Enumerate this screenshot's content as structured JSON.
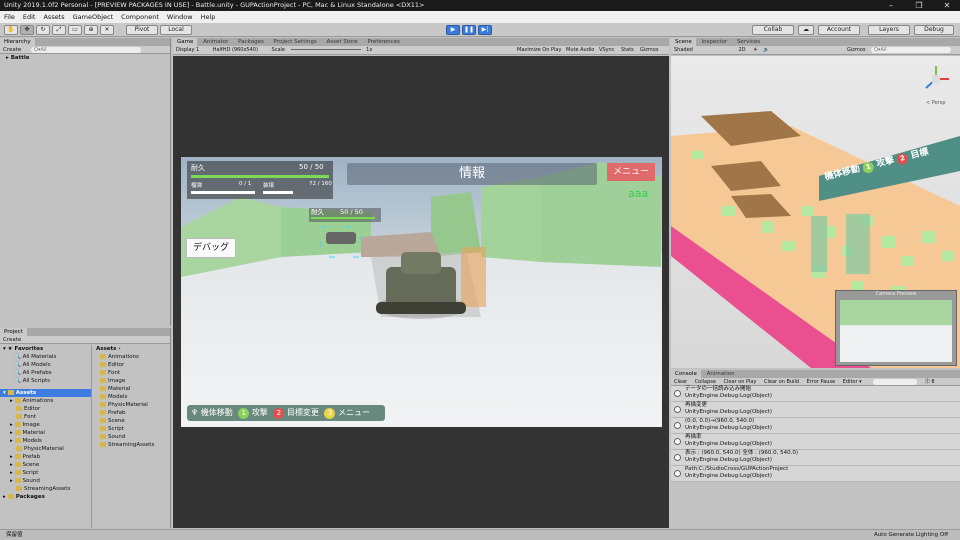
{
  "window": {
    "title": "Unity 2019.1.0f2 Personal - [PREVIEW PACKAGES IN USE] - Battle.unity - GUPActionProject - PC, Mac & Linux Standalone <DX11>"
  },
  "menu": [
    "File",
    "Edit",
    "Assets",
    "GameObject",
    "Component",
    "Window",
    "Help"
  ],
  "toolbar": {
    "pivot": "Pivot",
    "local": "Local",
    "collab": "Collab",
    "account": "Account",
    "layers": "Layers",
    "layout": "Debug"
  },
  "hierarchy": {
    "tab": "Hierarchy",
    "create": "Create",
    "search": "Q▾All",
    "scene": "Battle"
  },
  "project": {
    "tab": "Project",
    "create": "Create",
    "favorites_header": "Favorites",
    "favorites": [
      "All Materials",
      "All Models",
      "All Prefabs",
      "All Scripts"
    ],
    "assets_header": "Assets",
    "asset_tree": [
      "Animations",
      "Editor",
      "Font",
      "Image",
      "Material",
      "Models",
      "PhysicMaterial",
      "Prefab",
      "Scene",
      "Script",
      "Sound",
      "StreamingAssets"
    ],
    "packages": "Packages",
    "breadcrumb": "Assets ›",
    "asset_list": [
      "Animations",
      "Editor",
      "Font",
      "Image",
      "Material",
      "Models",
      "PhysicMaterial",
      "Prefab",
      "Scene",
      "Script",
      "Sound",
      "StreamingAssets"
    ]
  },
  "game": {
    "tabs": [
      "Game",
      "Animator",
      "Packages",
      "Project Settings",
      "Asset Store",
      "Preferences"
    ],
    "display": "Display 1",
    "resolution": "HalfHD (960x540)",
    "scale_label": "Scale",
    "scale_value": "1x",
    "opts": [
      "Maximize On Play",
      "Mute Audio",
      "VSync",
      "Stats",
      "Gizmos"
    ]
  },
  "hud": {
    "durability_label": "耐久",
    "durability": "50 / 50",
    "ammo_label": "榴弾",
    "ammo": "0 / 1",
    "armor_label": "装填",
    "armor": "72 / 160",
    "info": "情報",
    "menu": "メニュー",
    "aaa": "aaa",
    "debug": "デバッグ",
    "enemy_label": "耐久",
    "enemy_value": "50 / 50",
    "bottom_move": "機体移動",
    "bottom_1": "攻撃",
    "bottom_2": "目標変更",
    "bottom_3": "メニュー"
  },
  "scene": {
    "tabs": [
      "Scene",
      "Inspector",
      "Services"
    ],
    "shading": "Shaded",
    "mode": "2D",
    "gizmos": "Gizmos",
    "search": "Q▾All",
    "persp": "< Persp",
    "banner_move": "機体移動",
    "banner_1": "攻撃",
    "banner_2": "目標",
    "camera_preview": "Camera Preview"
  },
  "console": {
    "tabs": [
      "Console",
      "Animation"
    ],
    "buttons": [
      "Clear",
      "Collapse",
      "Clear on Play",
      "Clear on Build",
      "Error Pause",
      "Editor ▾"
    ],
    "counts": "⓵ 8",
    "lines": [
      [
        "データの一括読み込み開始",
        "UnityEngine.Debug:Log(Object)"
      ],
      [
        "再描変更",
        "UnityEngine.Debug:Log(Object)"
      ],
      [
        "(0.0, 0.0)→(960.0, 540.0)",
        "UnityEngine.Debug:Log(Object)"
      ],
      [
        "再描率",
        "UnityEngine.Debug:Log(Object)"
      ],
      [
        "表示 : (960.0, 540.0)  全体 : (960.0, 540.0)",
        "UnityEngine.Debug:Log(Object)"
      ],
      [
        "Path:C:/StudioCross/GUPActionProject",
        "UnityEngine.Debug:Log(Object)"
      ]
    ]
  },
  "status": {
    "left": "保留値",
    "right": "Auto Generate Lighting Off"
  },
  "colors": {
    "accent": "#3b7bd6",
    "menu_red": "#e06a6a",
    "hud_green": "#7ed957",
    "terrain": "#f6c896"
  }
}
